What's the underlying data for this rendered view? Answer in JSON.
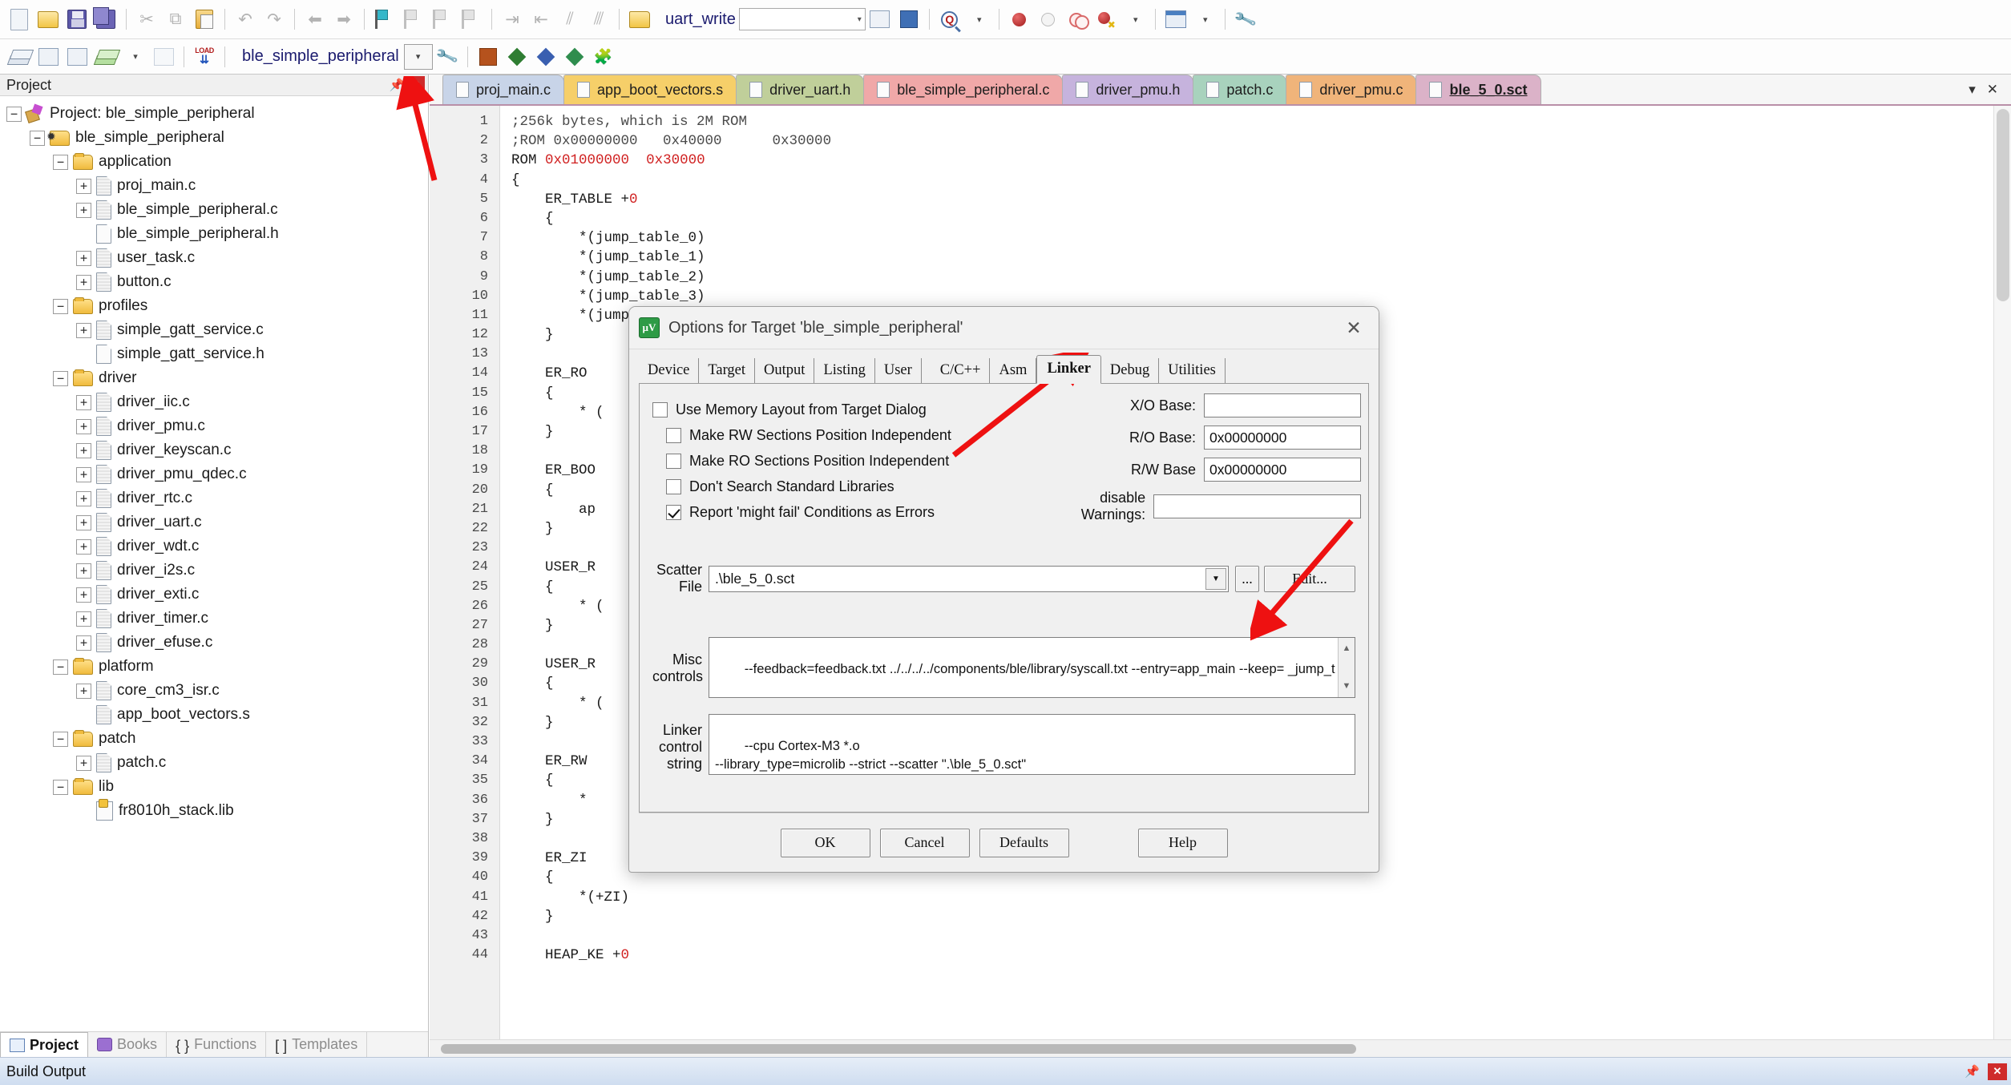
{
  "toolbar_main": {
    "function_name": "uart_write",
    "icons": [
      "new-file-icon",
      "open-folder-icon",
      "save-icon",
      "save-all-icon",
      "cut-icon",
      "copy-icon",
      "paste-icon",
      "undo-icon",
      "redo-icon",
      "navigate-back-icon",
      "navigate-forward-icon",
      "bookmark-toggle-icon",
      "bookmark-prev-icon",
      "bookmark-next-icon",
      "bookmark-clear-icon",
      "indent-icon",
      "outdent-icon",
      "comment-icon",
      "uncomment-icon",
      "open-function-icon",
      "dropdown-icon",
      "insert-file-icon",
      "import-icon",
      "find-in-files-icon",
      "breakpoint-icon",
      "breakpoint-disable-icon",
      "breakpoint-list-icon",
      "breakpoint-kill-icon",
      "window-layout-icon",
      "configure-icon"
    ]
  },
  "toolbar_second": {
    "target_name": "ble_simple_peripheral",
    "icons": [
      "translate-icon",
      "build-icon",
      "rebuild-icon",
      "batch-build-icon",
      "batch-build-dropdown-icon",
      "stop-build-icon",
      "load-icon",
      "target-options-icon",
      "manage-components-icon",
      "pack-installer-icon",
      "svcs-icon",
      "utilities-icon"
    ]
  },
  "project_panel": {
    "title": "Project",
    "pin_icon": "pin-icon",
    "close_icon": "close-icon",
    "tree": [
      {
        "label": "Project: ble_simple_peripheral",
        "depth": 0,
        "icon": "project-icon",
        "expander": "minus"
      },
      {
        "label": "ble_simple_peripheral",
        "depth": 1,
        "icon": "target-icon",
        "expander": "minus"
      },
      {
        "label": "application",
        "depth": 2,
        "icon": "folder-icon",
        "expander": "minus"
      },
      {
        "label": "proj_main.c",
        "depth": 3,
        "icon": "source-file-icon",
        "expander": "plus"
      },
      {
        "label": "ble_simple_peripheral.c",
        "depth": 3,
        "icon": "source-file-icon",
        "expander": "plus"
      },
      {
        "label": "ble_simple_peripheral.h",
        "depth": 3,
        "icon": "header-file-icon",
        "expander": "none"
      },
      {
        "label": "user_task.c",
        "depth": 3,
        "icon": "source-file-icon",
        "expander": "plus"
      },
      {
        "label": "button.c",
        "depth": 3,
        "icon": "source-file-icon",
        "expander": "plus"
      },
      {
        "label": "profiles",
        "depth": 2,
        "icon": "folder-icon",
        "expander": "minus"
      },
      {
        "label": "simple_gatt_service.c",
        "depth": 3,
        "icon": "source-file-icon",
        "expander": "plus"
      },
      {
        "label": "simple_gatt_service.h",
        "depth": 3,
        "icon": "header-file-icon",
        "expander": "none"
      },
      {
        "label": "driver",
        "depth": 2,
        "icon": "folder-icon",
        "expander": "minus"
      },
      {
        "label": "driver_iic.c",
        "depth": 3,
        "icon": "source-file-icon",
        "expander": "plus"
      },
      {
        "label": "driver_pmu.c",
        "depth": 3,
        "icon": "source-file-icon",
        "expander": "plus"
      },
      {
        "label": "driver_keyscan.c",
        "depth": 3,
        "icon": "source-file-icon",
        "expander": "plus"
      },
      {
        "label": "driver_pmu_qdec.c",
        "depth": 3,
        "icon": "source-file-icon",
        "expander": "plus"
      },
      {
        "label": "driver_rtc.c",
        "depth": 3,
        "icon": "source-file-icon",
        "expander": "plus"
      },
      {
        "label": "driver_uart.c",
        "depth": 3,
        "icon": "source-file-icon",
        "expander": "plus"
      },
      {
        "label": "driver_wdt.c",
        "depth": 3,
        "icon": "source-file-icon",
        "expander": "plus"
      },
      {
        "label": "driver_i2s.c",
        "depth": 3,
        "icon": "source-file-icon",
        "expander": "plus"
      },
      {
        "label": "driver_exti.c",
        "depth": 3,
        "icon": "source-file-icon",
        "expander": "plus"
      },
      {
        "label": "driver_timer.c",
        "depth": 3,
        "icon": "source-file-icon",
        "expander": "plus"
      },
      {
        "label": "driver_efuse.c",
        "depth": 3,
        "icon": "source-file-icon",
        "expander": "plus"
      },
      {
        "label": "platform",
        "depth": 2,
        "icon": "folder-icon",
        "expander": "minus"
      },
      {
        "label": "core_cm3_isr.c",
        "depth": 3,
        "icon": "source-file-icon",
        "expander": "plus"
      },
      {
        "label": "app_boot_vectors.s",
        "depth": 3,
        "icon": "source-file-icon",
        "expander": "none"
      },
      {
        "label": "patch",
        "depth": 2,
        "icon": "folder-icon",
        "expander": "minus"
      },
      {
        "label": "patch.c",
        "depth": 3,
        "icon": "source-file-icon",
        "expander": "plus"
      },
      {
        "label": "lib",
        "depth": 2,
        "icon": "folder-icon",
        "expander": "minus"
      },
      {
        "label": "fr8010h_stack.lib",
        "depth": 3,
        "icon": "library-file-icon",
        "expander": "none"
      }
    ],
    "tabs": [
      {
        "label": "Project",
        "icon": "project-tab-icon",
        "active": true
      },
      {
        "label": "Books",
        "icon": "books-tab-icon",
        "active": false
      },
      {
        "label": "Functions",
        "icon": "functions-tab-icon",
        "active": false
      },
      {
        "label": "Templates",
        "icon": "templates-tab-icon",
        "active": false
      }
    ]
  },
  "editor": {
    "tabs": [
      {
        "label": "proj_main.c",
        "color": "#c8d4e8",
        "active": false
      },
      {
        "label": "app_boot_vectors.s",
        "color": "#f6cf69",
        "active": false
      },
      {
        "label": "driver_uart.h",
        "color": "#c0cf9a",
        "active": false
      },
      {
        "label": "ble_simple_peripheral.c",
        "color": "#f0a8a8",
        "active": false
      },
      {
        "label": "driver_pmu.h",
        "color": "#c6b3dd",
        "active": false
      },
      {
        "label": "patch.c",
        "color": "#a8d2bd",
        "active": false
      },
      {
        "label": "driver_pmu.c",
        "color": "#f0b47a",
        "active": false
      },
      {
        "label": "ble_5_0.sct",
        "color": "#dbb2c8",
        "active": true
      }
    ],
    "tab_dropdown_icon": "chevron-down-icon",
    "tab_close_icon": "close-icon",
    "code_lines": [
      {
        "n": 1,
        "text": ";256k bytes, which is 2M ROM",
        "style": "cmt"
      },
      {
        "n": 2,
        "text": ";ROM 0x00000000   0x40000      0x30000",
        "style": "cmt"
      },
      {
        "n": 3,
        "text": "ROM 0x01000000  0x30000",
        "style": "rom"
      },
      {
        "n": 4,
        "text": "{",
        "style": ""
      },
      {
        "n": 5,
        "text": "    ER_TABLE +0",
        "style": "plus0"
      },
      {
        "n": 6,
        "text": "    {",
        "style": ""
      },
      {
        "n": 7,
        "text": "        *(jump_table_0)",
        "style": ""
      },
      {
        "n": 8,
        "text": "        *(jump_table_1)",
        "style": ""
      },
      {
        "n": 9,
        "text": "        *(jump_table_2)",
        "style": ""
      },
      {
        "n": 10,
        "text": "        *(jump_table_3)",
        "style": ""
      },
      {
        "n": 11,
        "text": "        *(jump_table_4)",
        "style": ""
      },
      {
        "n": 12,
        "text": "    }",
        "style": ""
      },
      {
        "n": 13,
        "text": "",
        "style": ""
      },
      {
        "n": 14,
        "text": "    ER_RO",
        "style": ""
      },
      {
        "n": 15,
        "text": "    {",
        "style": ""
      },
      {
        "n": 16,
        "text": "        * (",
        "style": ""
      },
      {
        "n": 17,
        "text": "    }",
        "style": ""
      },
      {
        "n": 18,
        "text": "",
        "style": ""
      },
      {
        "n": 19,
        "text": "    ER_BOO",
        "style": ""
      },
      {
        "n": 20,
        "text": "    {",
        "style": ""
      },
      {
        "n": 21,
        "text": "        ap",
        "style": ""
      },
      {
        "n": 22,
        "text": "    }",
        "style": ""
      },
      {
        "n": 23,
        "text": "",
        "style": ""
      },
      {
        "n": 24,
        "text": "    USER_R",
        "style": ""
      },
      {
        "n": 25,
        "text": "    {",
        "style": ""
      },
      {
        "n": 26,
        "text": "        * (",
        "style": ""
      },
      {
        "n": 27,
        "text": "    }",
        "style": ""
      },
      {
        "n": 28,
        "text": "",
        "style": ""
      },
      {
        "n": 29,
        "text": "    USER_R",
        "style": ""
      },
      {
        "n": 30,
        "text": "    {",
        "style": ""
      },
      {
        "n": 31,
        "text": "        * (",
        "style": ""
      },
      {
        "n": 32,
        "text": "    }",
        "style": ""
      },
      {
        "n": 33,
        "text": "",
        "style": ""
      },
      {
        "n": 34,
        "text": "    ER_RW",
        "style": ""
      },
      {
        "n": 35,
        "text": "    {",
        "style": ""
      },
      {
        "n": 36,
        "text": "        *",
        "style": ""
      },
      {
        "n": 37,
        "text": "    }",
        "style": ""
      },
      {
        "n": 38,
        "text": "",
        "style": ""
      },
      {
        "n": 39,
        "text": "    ER_ZI",
        "style": ""
      },
      {
        "n": 40,
        "text": "    {",
        "style": ""
      },
      {
        "n": 41,
        "text": "        *(+ZI)",
        "style": ""
      },
      {
        "n": 42,
        "text": "    }",
        "style": ""
      },
      {
        "n": 43,
        "text": "",
        "style": ""
      },
      {
        "n": 44,
        "text": "    HEAP_KE +0",
        "style": "plus0"
      }
    ]
  },
  "build_output": {
    "title": "Build Output",
    "pin_icon": "pin-icon",
    "close_icon": "close-icon"
  },
  "dialog": {
    "icon": "keil-uvision-icon",
    "title": "Options for Target 'ble_simple_peripheral'",
    "close_icon": "close-icon",
    "tabs": [
      {
        "label": "Device",
        "active": false
      },
      {
        "label": "Target",
        "active": false
      },
      {
        "label": "Output",
        "active": false
      },
      {
        "label": "Listing",
        "active": false
      },
      {
        "label": "User",
        "active": false
      },
      {
        "label": "C/C++",
        "active": false
      },
      {
        "label": "Asm",
        "active": false
      },
      {
        "label": "Linker",
        "active": true
      },
      {
        "label": "Debug",
        "active": false
      },
      {
        "label": "Utilities",
        "active": false
      }
    ],
    "checkboxes": [
      {
        "label": "Use Memory Layout from Target Dialog",
        "checked": false,
        "indent": 0
      },
      {
        "label": "Make RW Sections Position Independent",
        "checked": false,
        "indent": 1
      },
      {
        "label": "Make RO Sections Position Independent",
        "checked": false,
        "indent": 1
      },
      {
        "label": "Don't Search Standard Libraries",
        "checked": false,
        "indent": 1
      },
      {
        "label": "Report 'might fail' Conditions as Errors",
        "checked": true,
        "indent": 1
      }
    ],
    "fields": [
      {
        "label": "X/O Base:",
        "value": ""
      },
      {
        "label": "R/O Base:",
        "value": "0x00000000"
      },
      {
        "label": "R/W Base",
        "value": "0x00000000"
      },
      {
        "label": "disable Warnings:",
        "value": ""
      }
    ],
    "scatter": {
      "label_line1": "Scatter",
      "label_line2": "File",
      "value": ".\\ble_5_0.sct",
      "dropdown_icon": "chevron-down-icon",
      "browse_label": "...",
      "edit_label": "Edit..."
    },
    "misc": {
      "label_line1": "Misc",
      "label_line2": "controls",
      "value": "--feedback=feedback.txt ../../../../components/ble/library/syscall.txt --entry=app_main --keep= _jump_t",
      "scroll_up_icon": "scroll-up-icon",
      "scroll_down_icon": "scroll-down-icon"
    },
    "linker_control": {
      "label_line1": "Linker",
      "label_line2": "control",
      "label_line3": "string",
      "value": "--cpu Cortex-M3 *.o\n--library_type=microlib --strict --scatter \".\\ble_5_0.sct\""
    },
    "buttons": [
      {
        "label": "OK"
      },
      {
        "label": "Cancel"
      },
      {
        "label": "Defaults"
      },
      {
        "label": "Help"
      }
    ]
  },
  "annotations": {
    "color": "#ee1111",
    "arrows": [
      {
        "name": "arrow-to-project-panel-close"
      },
      {
        "name": "arrow-to-linker-tab"
      },
      {
        "name": "arrow-to-edit-button"
      }
    ]
  }
}
